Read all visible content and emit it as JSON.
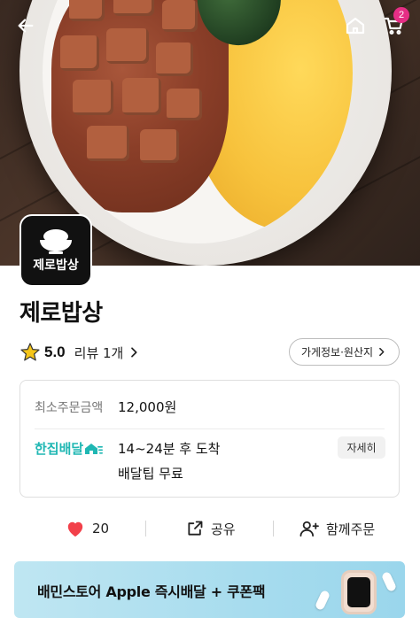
{
  "header": {
    "back_icon": "arrow-left-icon",
    "home_icon": "home-icon",
    "cart_icon": "cart-icon",
    "cart_count": "2"
  },
  "store": {
    "logo_text": "제로밥상",
    "name": "제로밥상",
    "rating": "5.0",
    "review_label": "리뷰 1개",
    "info_button": "가게정보·원산지"
  },
  "delivery_card": {
    "min_order_label": "최소주문금액",
    "min_order_value": "12,000원",
    "service_name": "한집배달",
    "eta": "14~24분 후 도착",
    "tip": "배달팁 무료",
    "detail_button": "자세히"
  },
  "actions": {
    "like_count": "20",
    "share_label": "공유",
    "group_order_label": "함께주문"
  },
  "banner": {
    "text": "배민스토어 Apple 즉시배달 + 쿠폰팩"
  },
  "colors": {
    "accent_mint": "#1fb7b3",
    "badge_pink": "#e62e85",
    "heart_red": "#f2404a",
    "star_yellow": "#f5c518"
  }
}
